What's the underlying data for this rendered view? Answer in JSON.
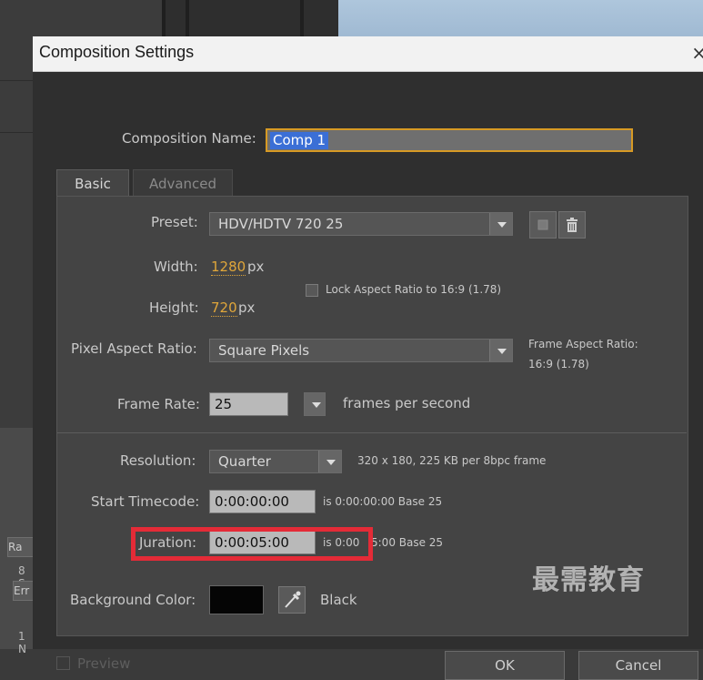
{
  "background": {
    "left_items": [
      "Ra",
      "8 S",
      "Err",
      "1 N"
    ]
  },
  "dialog": {
    "title": "Composition Settings",
    "close_glyph": "×",
    "composition_name_label": "Composition Name:",
    "composition_name_value": "Comp 1",
    "tabs": [
      {
        "label": "Basic",
        "active": true
      },
      {
        "label": "Advanced",
        "active": false
      }
    ],
    "preset_label": "Preset:",
    "preset_value": "HDV/HDTV 720 25",
    "width_label": "Width:",
    "width_value": "1280",
    "height_label": "Height:",
    "height_value": "720",
    "unit_px": "px",
    "lock_aspect_label": "Lock Aspect Ratio to 16:9 (1.78)",
    "pixel_aspect_label": "Pixel Aspect Ratio:",
    "pixel_aspect_value": "Square Pixels",
    "frame_aspect_label": "Frame Aspect Ratio:",
    "frame_aspect_value": "16:9 (1.78)",
    "frame_rate_label": "Frame Rate:",
    "frame_rate_value": "25",
    "frame_rate_unit": "frames per second",
    "resolution_label": "Resolution:",
    "resolution_value": "Quarter",
    "resolution_info": "320 x 180, 225 KB per 8bpc frame",
    "start_timecode_label": "Start Timecode:",
    "start_timecode_value": "0:00:00:00",
    "start_timecode_info": "is 0:00:00:00  Base 25",
    "duration_label": "Duration:",
    "duration_visible_label": "Juration:",
    "duration_value": "0:00:05:00",
    "duration_info_a": "is 0:00",
    "duration_info_b": "5:00  Base 25",
    "bg_color_label": "Background Color:",
    "bg_color_name": "Black",
    "bg_color_hex": "#050505",
    "preview_label": "Preview",
    "ok_label": "OK",
    "cancel_label": "Cancel",
    "highlight_color": "#e42b37",
    "accent_color": "#d79a24"
  },
  "watermark": "最需教育"
}
